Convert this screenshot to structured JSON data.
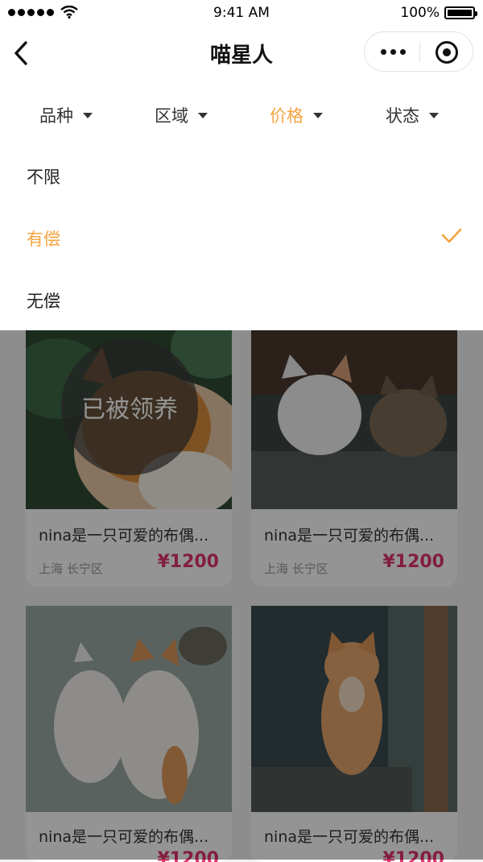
{
  "status_bar": {
    "time": "9:41 AM",
    "battery": "100%"
  },
  "nav": {
    "title": "喵星人"
  },
  "filters": [
    {
      "label": "品种",
      "active": false
    },
    {
      "label": "区域",
      "active": false
    },
    {
      "label": "价格",
      "active": true
    },
    {
      "label": "状态",
      "active": false
    }
  ],
  "price_options": [
    {
      "label": "不限",
      "selected": false
    },
    {
      "label": "有偿",
      "selected": true
    },
    {
      "label": "无偿",
      "selected": false
    }
  ],
  "listings": [
    {
      "name": "nina是一只可爱的布偶...",
      "location": "上海 长宁区",
      "price": "¥1200",
      "badge": "已被领养"
    },
    {
      "name": "nina是一只可爱的布偶...",
      "location": "上海 长宁区",
      "price": "¥1200"
    },
    {
      "name": "nina是一只可爱的布偶...",
      "price": "¥1200"
    },
    {
      "name": "nina是一只可爱的布偶...",
      "price": "¥1200"
    }
  ],
  "colors": {
    "accent": "#f6a340",
    "price": "#e0356b",
    "overlay": "rgba(0,0,0,0.42)"
  },
  "icons": [
    "signal-dots-icon",
    "wifi-icon",
    "battery-icon",
    "back-arrow-icon",
    "more-dots-icon",
    "close-target-icon",
    "dropdown-triangle-icon",
    "checkmark-icon"
  ]
}
